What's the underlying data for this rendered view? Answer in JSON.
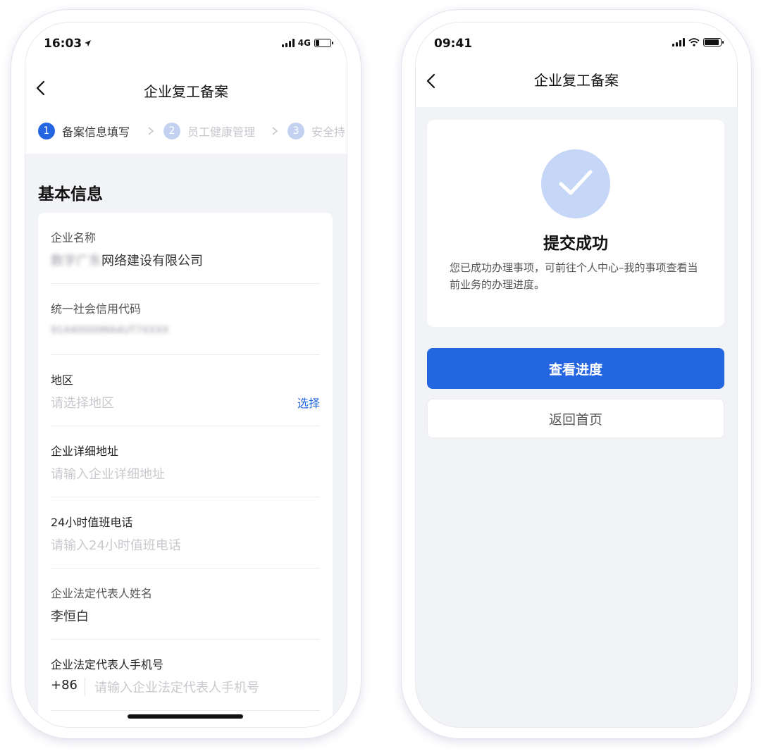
{
  "left_screen": {
    "status_bar": {
      "time": "16:03",
      "network": "4G"
    },
    "nav": {
      "title": "企业复工备案"
    },
    "steps": [
      {
        "num": "1",
        "label": "备案信息填写",
        "state": "active"
      },
      {
        "num": "2",
        "label": "员工健康管理",
        "state": "inactive"
      },
      {
        "num": "3",
        "label": "安全持",
        "state": "inactive"
      }
    ],
    "section_title": "基本信息",
    "fields": {
      "company_name": {
        "label": "企业名称",
        "value_blurred": "数字广东",
        "value": "网络建设有限公司"
      },
      "credit_code": {
        "label": "统一社会信用代码",
        "value_blurred": "91440000MA4UT7XXXX"
      },
      "region": {
        "label": "地区",
        "placeholder": "请选择地区",
        "action": "选择"
      },
      "address": {
        "label": "企业详细地址",
        "placeholder": "请输入企业详细地址"
      },
      "hotline": {
        "label": "24小时值班电话",
        "placeholder": "请输入24小时值班电话"
      },
      "legal_rep": {
        "label": "企业法定代表人姓名",
        "value": "李恒白"
      },
      "legal_phone": {
        "label": "企业法定代表人手机号",
        "country_code": "+86",
        "placeholder": "请输入企业法定代表人手机号"
      }
    }
  },
  "right_screen": {
    "status_bar": {
      "time": "09:41"
    },
    "nav": {
      "title": "企业复工备案"
    },
    "success": {
      "title": "提交成功",
      "description": "您已成功办理事项，可前往个人中心–我的事项查看当前业务的办理进度。"
    },
    "buttons": {
      "primary": "查看进度",
      "secondary": "返回首页"
    }
  },
  "colors": {
    "accent": "#2366e0",
    "step_inactive": "#c4d2f1",
    "check_bg": "#c6d6f7",
    "page_bg": "#f2f3f6"
  },
  "icons": [
    "back-arrow-icon",
    "location-arrow-icon",
    "signal-icon",
    "battery-icon",
    "wifi-icon",
    "chevron-right-icon",
    "checkmark-icon"
  ]
}
